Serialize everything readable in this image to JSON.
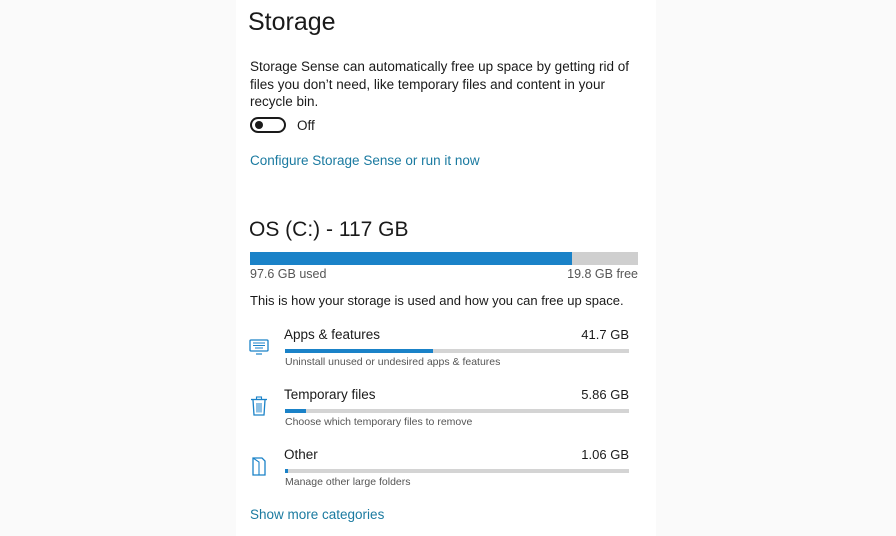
{
  "header": {
    "title": "Storage"
  },
  "storage_sense": {
    "description": "Storage Sense can automatically free up space by getting rid of files you don’t need, like temporary files and content in your recycle bin.",
    "toggle_state": "Off",
    "toggle_on": false,
    "configure_link": "Configure Storage Sense or run it now"
  },
  "drive": {
    "title": "OS (C:) - 117 GB",
    "used_label": "97.6 GB used",
    "free_label": "19.8 GB free",
    "used_fraction": 0.831,
    "accent_color": "#1a82c8"
  },
  "usage": {
    "intro": "This is how your storage is used and how you can free up space.",
    "categories": [
      {
        "icon": "apps-keyboard-icon",
        "name": "Apps & features",
        "size": "41.7 GB",
        "fraction": 0.43,
        "subtitle": "Uninstall unused or undesired apps & features"
      },
      {
        "icon": "trash-icon",
        "name": "Temporary files",
        "size": "5.86 GB",
        "fraction": 0.06,
        "subtitle": "Choose which temporary files to remove"
      },
      {
        "icon": "folder-icon",
        "name": "Other",
        "size": "1.06 GB",
        "fraction": 0.01,
        "subtitle": "Manage other large folders"
      }
    ],
    "more_link": "Show more categories"
  }
}
